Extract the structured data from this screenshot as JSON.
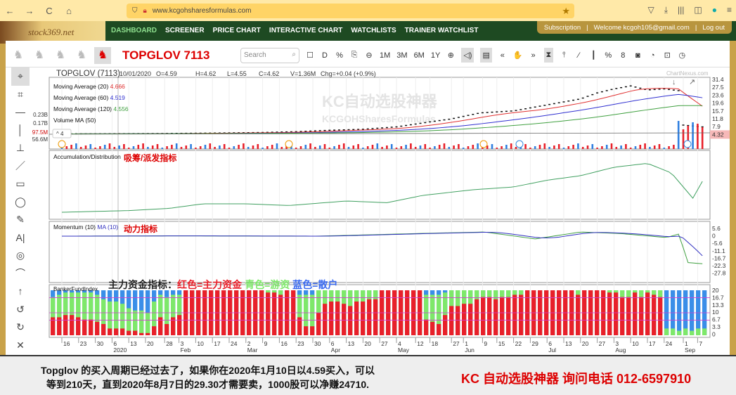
{
  "browser": {
    "url": "www.kcgohsharesformulas.com",
    "nav_icons": [
      "←",
      "→",
      "C",
      "⌂"
    ],
    "right_icons": [
      "▽",
      "⤓",
      "|||",
      "◫",
      "●",
      "≡"
    ]
  },
  "nav": {
    "logo": "stock369.net",
    "menu": [
      "DASHBOARD",
      "SCREENER",
      "PRICE CHART",
      "INTERACTIVE CHART",
      "WATCHLISTS",
      "TRAINER WATCHLIST"
    ],
    "subscription": "Subscription",
    "welcome": "Welcome kcgoh105@gmail.com",
    "logout": "Log out"
  },
  "toolbar": {
    "title": "TOPGLOV 7113",
    "search_placeholder": "Search",
    "buttons": [
      "☐",
      "D",
      "%",
      "⎘",
      "⊖",
      "1M",
      "3M",
      "6M",
      "1Y",
      "⊕",
      "◁)",
      "▤",
      "«",
      "✋",
      "»",
      "⧗",
      "⫯",
      "∕",
      "┃",
      "%",
      "8",
      "◙",
      "◔",
      "⊡",
      "◷"
    ]
  },
  "left_tools": [
    "⌖",
    "⌗",
    "—",
    "│",
    "⊥",
    "／",
    "▭",
    "◯",
    "✎",
    "A|",
    "◎",
    "⌒",
    "↑",
    "↺",
    "↻",
    "✕"
  ],
  "chart": {
    "symbol": "TOPGLOV (7113)",
    "date": "10/01/2020",
    "open": "O=4.59",
    "high": "H=4.62",
    "low": "L=4.55",
    "close": "C=4.62",
    "volume": "V=1.36M",
    "change": "Chg=+0.04 (+0.9%)",
    "source": "ChartNexus.com",
    "watermark1": "KC自动选股神器",
    "watermark2": "KCGOHSharesFormulas",
    "legend": [
      {
        "label": "Moving Average (20)",
        "value": "4.666",
        "color": "#e03030"
      },
      {
        "label": "Moving Average (60)",
        "value": "4.519",
        "color": "#3030d0"
      },
      {
        "label": "Moving Average (120)",
        "value": "4.556",
        "color": "#40a040"
      },
      {
        "label": "Volume MA (50)",
        "value": "",
        "color": "#000"
      }
    ],
    "collapse": "^ 4",
    "vol_ticks": [
      "0.23B",
      "0.17B",
      "97.5M",
      "56.6M"
    ],
    "price_ticks": [
      "31.4",
      "27.5",
      "23.6",
      "19.6",
      "15.7",
      "11.8",
      "7.9",
      "4.32"
    ],
    "accum_label": "Accumulation/Distribution",
    "accum_note": "吸筹/派发指标",
    "mom_label": "Momentum (10)",
    "mom_ma": "MA (10)",
    "mom_note": "动力指标",
    "mom_ticks": [
      "5.6",
      "0",
      "-5.6",
      "-11.1",
      "-16.7",
      "-22.3",
      "-27.8"
    ],
    "banker_label": "BankerFundIndex",
    "banker_note": [
      "主力资金指标：",
      "红色=主力资金",
      "青色=游资",
      "蓝色=散户"
    ],
    "banker_ticks": [
      "20",
      "16.7",
      "13.3",
      "10",
      "6.7",
      "3.3",
      "0"
    ],
    "colors": {
      "red": "#e8202a",
      "green": "#7ee86a",
      "blue": "#3a8ee8",
      "up": "#e8202a",
      "down": "#2f7fe0"
    }
  },
  "chart_data": {
    "type": "line",
    "price": [
      [
        "2019-12-16",
        4.5
      ],
      [
        "2020-01-06",
        4.6
      ],
      [
        "2020-01-27",
        4.7
      ],
      [
        "2020-02-17",
        4.9
      ],
      [
        "2020-03-09",
        5.2
      ],
      [
        "2020-03-23",
        5.6
      ],
      [
        "2020-04-06",
        6.3
      ],
      [
        "2020-04-20",
        6.8
      ],
      [
        "2020-05-04",
        8.0
      ],
      [
        "2020-05-18",
        10.5
      ],
      [
        "2020-05-27",
        12.0
      ],
      [
        "2020-06-08",
        15.0
      ],
      [
        "2020-06-22",
        16.0
      ],
      [
        "2020-07-06",
        19.0
      ],
      [
        "2020-07-20",
        22.0
      ],
      [
        "2020-07-27",
        25.0
      ],
      [
        "2020-08-03",
        27.0
      ],
      [
        "2020-08-10",
        28.5
      ],
      [
        "2020-08-17",
        26.5
      ],
      [
        "2020-08-24",
        27.0
      ],
      [
        "2020-08-31",
        26.0
      ],
      [
        "2020-09-01",
        8.9
      ],
      [
        "2020-09-09",
        8.0
      ]
    ],
    "accum": [
      [
        "2019-12-16",
        5
      ],
      [
        "2020-01-13",
        8
      ],
      [
        "2020-01-30",
        12
      ],
      [
        "2020-02-13",
        20
      ],
      [
        "2020-03-02",
        20
      ],
      [
        "2020-03-20",
        17
      ],
      [
        "2020-04-13",
        25
      ],
      [
        "2020-04-30",
        22
      ],
      [
        "2020-05-15",
        35
      ],
      [
        "2020-06-05",
        45
      ],
      [
        "2020-06-22",
        50
      ],
      [
        "2020-07-06",
        62
      ],
      [
        "2020-07-20",
        70
      ],
      [
        "2020-08-03",
        85
      ],
      [
        "2020-08-17",
        92
      ],
      [
        "2020-08-27",
        75
      ],
      [
        "2020-09-05",
        30
      ],
      [
        "2020-09-09",
        60
      ]
    ],
    "momentum": [
      [
        "2019-12-16",
        0
      ],
      [
        "2020-02-01",
        0.2
      ],
      [
        "2020-04-01",
        0
      ],
      [
        "2020-05-15",
        2
      ],
      [
        "2020-06-10",
        3
      ],
      [
        "2020-07-01",
        -2
      ],
      [
        "2020-07-20",
        3
      ],
      [
        "2020-08-05",
        2
      ],
      [
        "2020-08-25",
        -1
      ],
      [
        "2020-08-31",
        2
      ],
      [
        "2020-09-02",
        -19
      ],
      [
        "2020-09-09",
        -20
      ]
    ],
    "banker_red": [
      8,
      8,
      9,
      9,
      8,
      7,
      7,
      6,
      5,
      3,
      3,
      3,
      2,
      2,
      1,
      1,
      4,
      8,
      5,
      8,
      9,
      20,
      20,
      20,
      20,
      20,
      20,
      20,
      20,
      20,
      20,
      20,
      20,
      20,
      19,
      19,
      18,
      20,
      20,
      8,
      4,
      4,
      10,
      14,
      15,
      15,
      14,
      13,
      15,
      15,
      16,
      16,
      20,
      20,
      20,
      20,
      20,
      20,
      20,
      7,
      6,
      5,
      9,
      13,
      13,
      14,
      14,
      16,
      17,
      17,
      16,
      17,
      17,
      18,
      18,
      20,
      20,
      20,
      20,
      20,
      20,
      20,
      20,
      18,
      20,
      20,
      20,
      20,
      19,
      19,
      17,
      17,
      19,
      17,
      19,
      18,
      17,
      0,
      0,
      0,
      0,
      0,
      0,
      0
    ],
    "banker_green": [
      9,
      10,
      10,
      10,
      11,
      12,
      12,
      12,
      11,
      12,
      12,
      11,
      10,
      9,
      10,
      9,
      11,
      10,
      12,
      10,
      9,
      0,
      0,
      0,
      0,
      0,
      0,
      0,
      0,
      0,
      0,
      0,
      0,
      0,
      1,
      1,
      2,
      0,
      0,
      10,
      14,
      14,
      10,
      6,
      5,
      5,
      6,
      7,
      5,
      5,
      4,
      4,
      0,
      0,
      0,
      0,
      0,
      0,
      0,
      11,
      12,
      13,
      10,
      7,
      7,
      6,
      6,
      4,
      3,
      3,
      4,
      3,
      3,
      2,
      2,
      0,
      0,
      0,
      0,
      0,
      0,
      0,
      0,
      2,
      0,
      0,
      0,
      0,
      1,
      1,
      3,
      3,
      1,
      3,
      1,
      2,
      3,
      3,
      3,
      2,
      3,
      2,
      3,
      3
    ],
    "date_ticks": [
      [
        "2019-12-16",
        "16",
        ""
      ],
      [
        "2019-12-23",
        "23",
        ""
      ],
      [
        "2019-12-30",
        "30",
        ""
      ],
      [
        "2020-01-06",
        "6",
        "2020"
      ],
      [
        "2020-01-13",
        "13",
        ""
      ],
      [
        "2020-01-20",
        "20",
        ""
      ],
      [
        "2020-01-28",
        "28",
        ""
      ],
      [
        "2020-02-03",
        "3",
        "Feb"
      ],
      [
        "2020-02-10",
        "10",
        ""
      ],
      [
        "2020-02-17",
        "17",
        ""
      ],
      [
        "2020-02-24",
        "24",
        ""
      ],
      [
        "2020-03-02",
        "2",
        "Mar"
      ],
      [
        "2020-03-09",
        "9",
        ""
      ],
      [
        "2020-03-16",
        "16",
        ""
      ],
      [
        "2020-03-23",
        "23",
        ""
      ],
      [
        "2020-03-30",
        "30",
        ""
      ],
      [
        "2020-04-06",
        "6",
        "Apr"
      ],
      [
        "2020-04-13",
        "13",
        ""
      ],
      [
        "2020-04-20",
        "20",
        ""
      ],
      [
        "2020-04-27",
        "27",
        ""
      ],
      [
        "2020-05-04",
        "4",
        "May"
      ],
      [
        "2020-05-12",
        "12",
        ""
      ],
      [
        "2020-05-18",
        "18",
        ""
      ],
      [
        "2020-05-27",
        "27",
        ""
      ],
      [
        "2020-06-01",
        "1",
        "Jun"
      ],
      [
        "2020-06-09",
        "9",
        ""
      ],
      [
        "2020-06-15",
        "15",
        ""
      ],
      [
        "2020-06-22",
        "22",
        ""
      ],
      [
        "2020-06-29",
        "29",
        ""
      ],
      [
        "2020-07-06",
        "6",
        "Jul"
      ],
      [
        "2020-07-13",
        "13",
        ""
      ],
      [
        "2020-07-20",
        "20",
        ""
      ],
      [
        "2020-07-27",
        "27",
        ""
      ],
      [
        "2020-08-03",
        "3",
        "Aug"
      ],
      [
        "2020-08-10",
        "10",
        ""
      ],
      [
        "2020-08-17",
        "17",
        ""
      ],
      [
        "2020-08-24",
        "24",
        ""
      ],
      [
        "2020-09-01",
        "1",
        "Sep"
      ],
      [
        "2020-09-07",
        "7",
        ""
      ]
    ]
  },
  "footer": {
    "line1": "Topglov 的买入周期已经过去了，如果你在2020年1月10日以4.59买入，可以",
    "line2": "等到210天，直到2020年8月7日的29.30才需要卖，1000股可以净赚24710.",
    "contact": "KC 自动选股神器 询问电话  012-6597910"
  }
}
